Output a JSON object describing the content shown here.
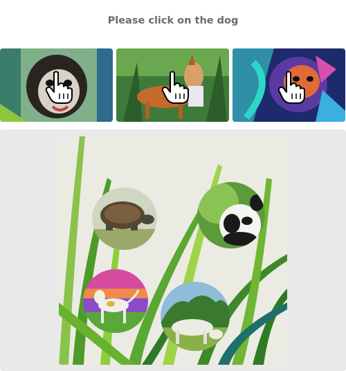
{
  "instruction": "Please click on the dog",
  "examples": [
    {
      "icon": "hand-pointer-icon",
      "subject": "dog"
    },
    {
      "icon": "hand-pointer-icon",
      "subject": "dog"
    },
    {
      "icon": "hand-pointer-icon",
      "subject": "dog"
    }
  ],
  "choices": [
    "turtle",
    "panda",
    "dog",
    "cow"
  ],
  "colors": {
    "panel_bg": "#e9e9e9",
    "canvas_bg": "#ecebe3",
    "text": "#6b6b6b",
    "grass": "#6fae2d"
  }
}
